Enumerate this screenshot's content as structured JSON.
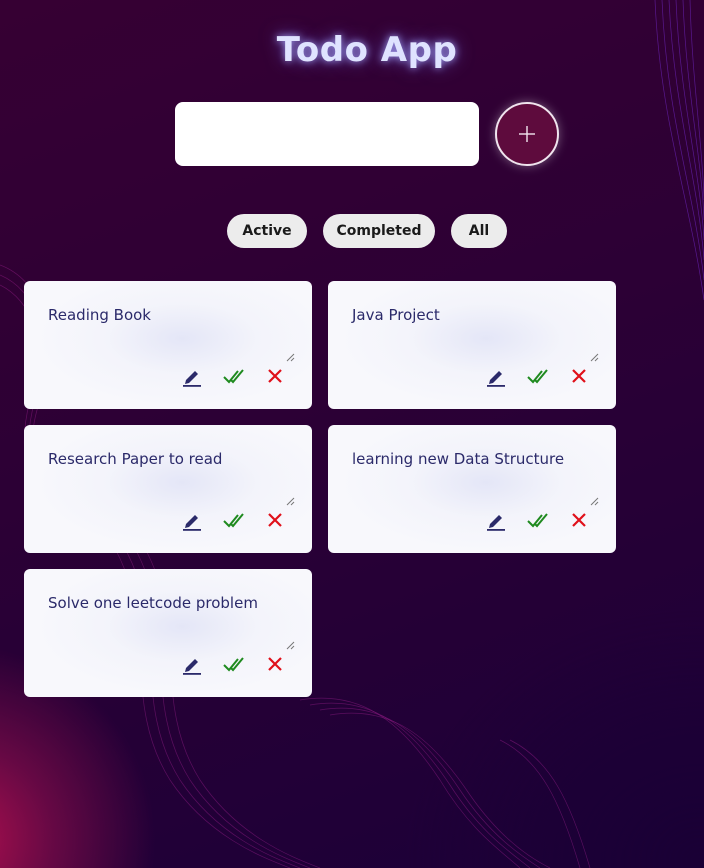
{
  "app": {
    "title": "Todo App"
  },
  "input": {
    "value": "",
    "placeholder": ""
  },
  "add_button": {
    "icon": "plus-icon"
  },
  "filters": [
    {
      "label": "Active"
    },
    {
      "label": "Completed"
    },
    {
      "label": "All"
    }
  ],
  "todos": [
    {
      "text": "Reading Book"
    },
    {
      "text": "Java Project"
    },
    {
      "text": "Research Paper to read"
    },
    {
      "text": "learning new Data Structure"
    },
    {
      "text": "Solve one leetcode problem"
    }
  ],
  "icons": {
    "edit": "pencil-icon",
    "complete": "double-check-icon",
    "delete": "close-icon"
  },
  "colors": {
    "edit": "#2b2a6a",
    "complete": "#1f8a1f",
    "delete": "#e0101a",
    "add_button": "#5e0b3d"
  }
}
